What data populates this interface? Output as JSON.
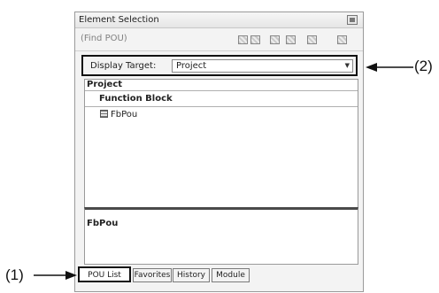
{
  "panel": {
    "title": "Element Selection",
    "find_placeholder": "(Find POU)",
    "display_target": {
      "label": "Display Target:",
      "value": "Project"
    },
    "tree": {
      "root": "Project",
      "group": "Function Block",
      "items": [
        "FbPou"
      ]
    },
    "detail": {
      "name": "FbPou"
    },
    "tabs": [
      "POU List",
      "Favorites",
      "History",
      "Module"
    ],
    "active_tab": "POU List"
  },
  "annotations": {
    "label_1": "(1)",
    "label_2": "(2)"
  },
  "icons": {
    "title": "window-icon",
    "toolbar": [
      "find-icon-1",
      "find-icon-2",
      "find-icon-3",
      "find-icon-4",
      "find-icon-5",
      "find-icon-6"
    ],
    "tree_item": "function-block-icon",
    "dropdown": "chevron-down-icon"
  }
}
